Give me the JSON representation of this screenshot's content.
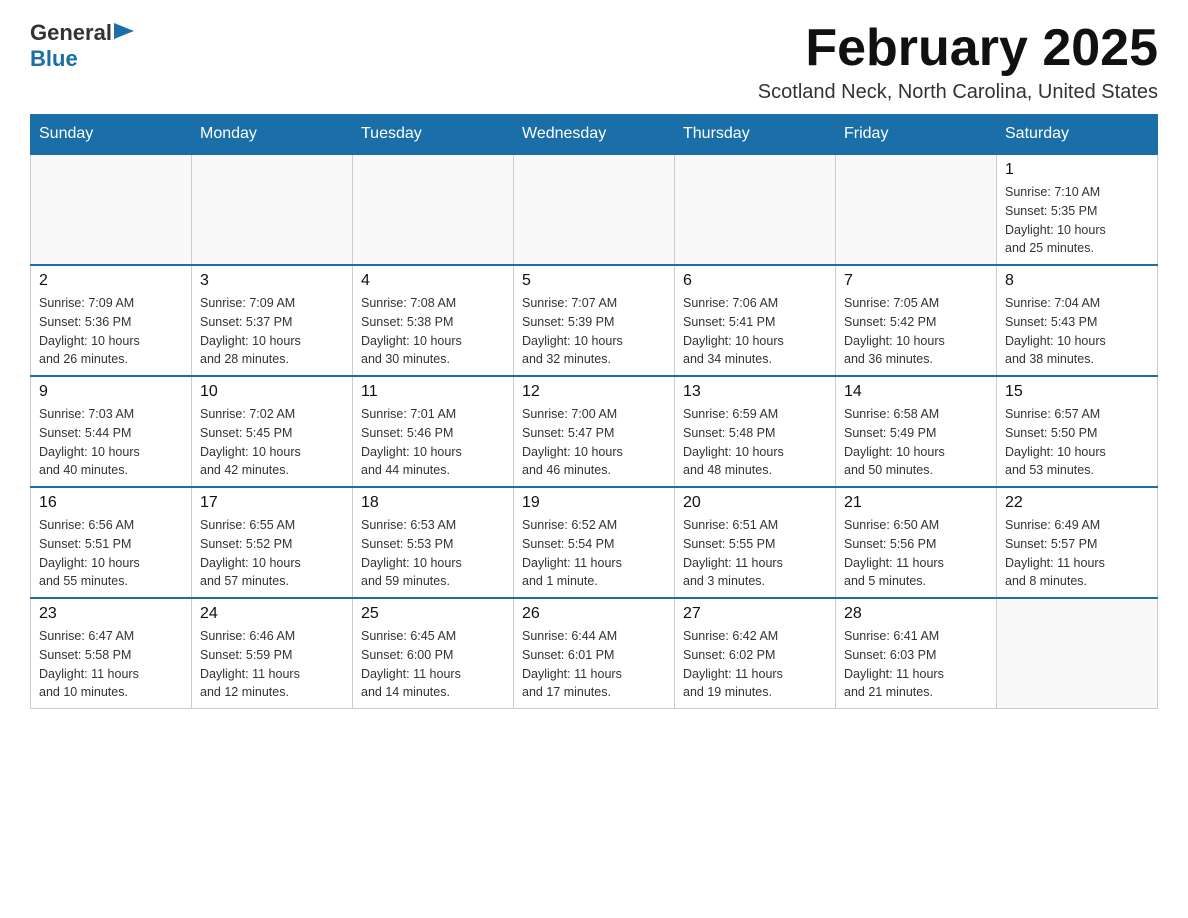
{
  "header": {
    "logo_general": "General",
    "logo_blue": "Blue",
    "title": "February 2025",
    "subtitle": "Scotland Neck, North Carolina, United States"
  },
  "weekdays": [
    "Sunday",
    "Monday",
    "Tuesday",
    "Wednesday",
    "Thursday",
    "Friday",
    "Saturday"
  ],
  "weeks": [
    [
      {
        "day": "",
        "info": ""
      },
      {
        "day": "",
        "info": ""
      },
      {
        "day": "",
        "info": ""
      },
      {
        "day": "",
        "info": ""
      },
      {
        "day": "",
        "info": ""
      },
      {
        "day": "",
        "info": ""
      },
      {
        "day": "1",
        "info": "Sunrise: 7:10 AM\nSunset: 5:35 PM\nDaylight: 10 hours\nand 25 minutes."
      }
    ],
    [
      {
        "day": "2",
        "info": "Sunrise: 7:09 AM\nSunset: 5:36 PM\nDaylight: 10 hours\nand 26 minutes."
      },
      {
        "day": "3",
        "info": "Sunrise: 7:09 AM\nSunset: 5:37 PM\nDaylight: 10 hours\nand 28 minutes."
      },
      {
        "day": "4",
        "info": "Sunrise: 7:08 AM\nSunset: 5:38 PM\nDaylight: 10 hours\nand 30 minutes."
      },
      {
        "day": "5",
        "info": "Sunrise: 7:07 AM\nSunset: 5:39 PM\nDaylight: 10 hours\nand 32 minutes."
      },
      {
        "day": "6",
        "info": "Sunrise: 7:06 AM\nSunset: 5:41 PM\nDaylight: 10 hours\nand 34 minutes."
      },
      {
        "day": "7",
        "info": "Sunrise: 7:05 AM\nSunset: 5:42 PM\nDaylight: 10 hours\nand 36 minutes."
      },
      {
        "day": "8",
        "info": "Sunrise: 7:04 AM\nSunset: 5:43 PM\nDaylight: 10 hours\nand 38 minutes."
      }
    ],
    [
      {
        "day": "9",
        "info": "Sunrise: 7:03 AM\nSunset: 5:44 PM\nDaylight: 10 hours\nand 40 minutes."
      },
      {
        "day": "10",
        "info": "Sunrise: 7:02 AM\nSunset: 5:45 PM\nDaylight: 10 hours\nand 42 minutes."
      },
      {
        "day": "11",
        "info": "Sunrise: 7:01 AM\nSunset: 5:46 PM\nDaylight: 10 hours\nand 44 minutes."
      },
      {
        "day": "12",
        "info": "Sunrise: 7:00 AM\nSunset: 5:47 PM\nDaylight: 10 hours\nand 46 minutes."
      },
      {
        "day": "13",
        "info": "Sunrise: 6:59 AM\nSunset: 5:48 PM\nDaylight: 10 hours\nand 48 minutes."
      },
      {
        "day": "14",
        "info": "Sunrise: 6:58 AM\nSunset: 5:49 PM\nDaylight: 10 hours\nand 50 minutes."
      },
      {
        "day": "15",
        "info": "Sunrise: 6:57 AM\nSunset: 5:50 PM\nDaylight: 10 hours\nand 53 minutes."
      }
    ],
    [
      {
        "day": "16",
        "info": "Sunrise: 6:56 AM\nSunset: 5:51 PM\nDaylight: 10 hours\nand 55 minutes."
      },
      {
        "day": "17",
        "info": "Sunrise: 6:55 AM\nSunset: 5:52 PM\nDaylight: 10 hours\nand 57 minutes."
      },
      {
        "day": "18",
        "info": "Sunrise: 6:53 AM\nSunset: 5:53 PM\nDaylight: 10 hours\nand 59 minutes."
      },
      {
        "day": "19",
        "info": "Sunrise: 6:52 AM\nSunset: 5:54 PM\nDaylight: 11 hours\nand 1 minute."
      },
      {
        "day": "20",
        "info": "Sunrise: 6:51 AM\nSunset: 5:55 PM\nDaylight: 11 hours\nand 3 minutes."
      },
      {
        "day": "21",
        "info": "Sunrise: 6:50 AM\nSunset: 5:56 PM\nDaylight: 11 hours\nand 5 minutes."
      },
      {
        "day": "22",
        "info": "Sunrise: 6:49 AM\nSunset: 5:57 PM\nDaylight: 11 hours\nand 8 minutes."
      }
    ],
    [
      {
        "day": "23",
        "info": "Sunrise: 6:47 AM\nSunset: 5:58 PM\nDaylight: 11 hours\nand 10 minutes."
      },
      {
        "day": "24",
        "info": "Sunrise: 6:46 AM\nSunset: 5:59 PM\nDaylight: 11 hours\nand 12 minutes."
      },
      {
        "day": "25",
        "info": "Sunrise: 6:45 AM\nSunset: 6:00 PM\nDaylight: 11 hours\nand 14 minutes."
      },
      {
        "day": "26",
        "info": "Sunrise: 6:44 AM\nSunset: 6:01 PM\nDaylight: 11 hours\nand 17 minutes."
      },
      {
        "day": "27",
        "info": "Sunrise: 6:42 AM\nSunset: 6:02 PM\nDaylight: 11 hours\nand 19 minutes."
      },
      {
        "day": "28",
        "info": "Sunrise: 6:41 AM\nSunset: 6:03 PM\nDaylight: 11 hours\nand 21 minutes."
      },
      {
        "day": "",
        "info": ""
      }
    ]
  ]
}
